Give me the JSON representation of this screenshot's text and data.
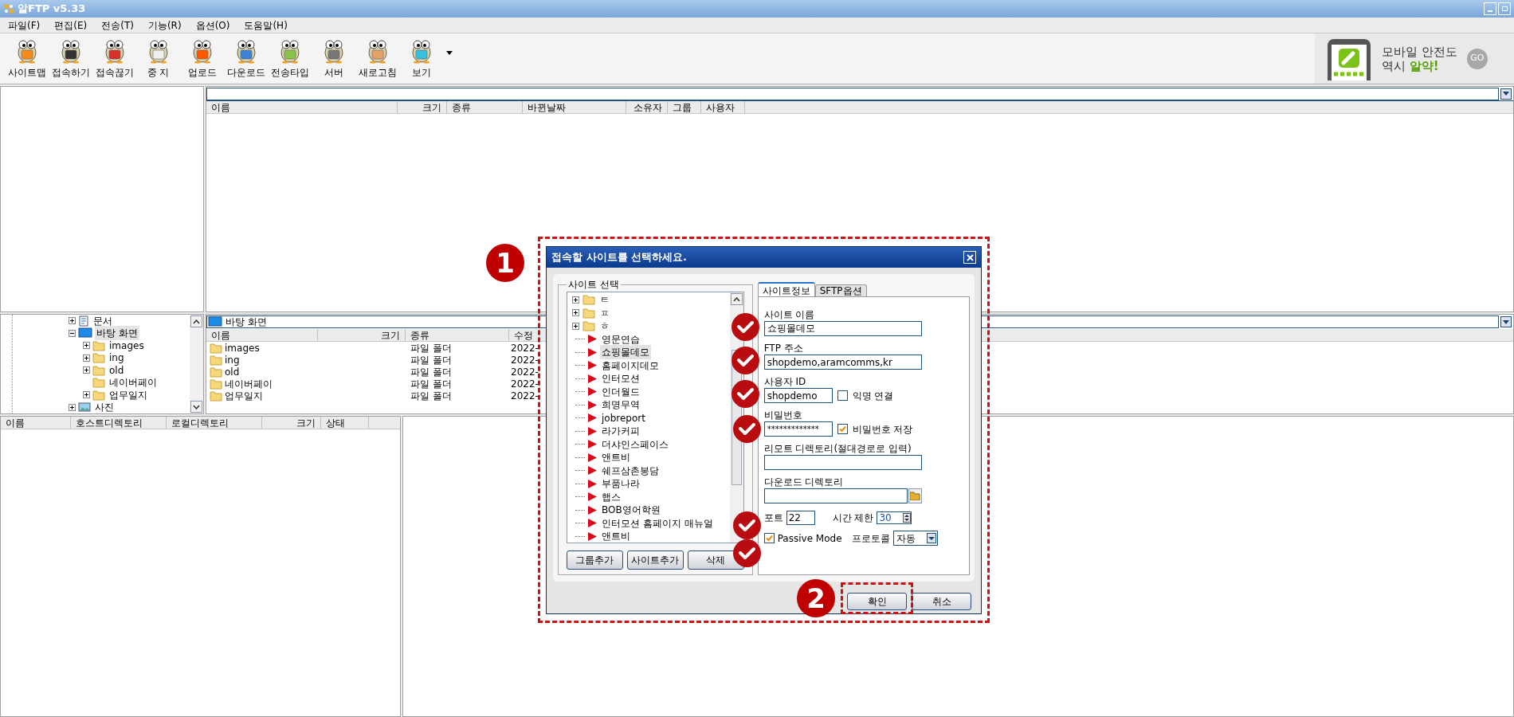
{
  "window": {
    "title": "알FTP  v5.33"
  },
  "menu": [
    {
      "label": "파일(F)"
    },
    {
      "label": "편집(E)"
    },
    {
      "label": "전송(T)"
    },
    {
      "label": "기능(R)"
    },
    {
      "label": "옵션(O)"
    },
    {
      "label": "도움말(H)"
    }
  ],
  "toolbar": [
    {
      "label": "사이트맵"
    },
    {
      "label": "접속하기"
    },
    {
      "label": "접속끊기"
    },
    {
      "label": "중 지"
    },
    {
      "label": "업로드"
    },
    {
      "label": "다운로드"
    },
    {
      "label": "전송타입"
    },
    {
      "label": "서버"
    },
    {
      "label": "새로고침"
    },
    {
      "label": "보기"
    }
  ],
  "ad": {
    "line1": "모바일 안전도",
    "line2": "역시 ",
    "highlight": "알약!",
    "go": "GO"
  },
  "remote": {
    "columns": [
      "이름",
      "크기",
      "종류",
      "바뀐날짜",
      "소유자",
      "그룹",
      "사용자"
    ]
  },
  "local_tree": [
    {
      "label": "문서",
      "kind": "document",
      "expanded": false,
      "selected": false
    },
    {
      "label": "바탕 화면",
      "kind": "desktop",
      "expanded": true,
      "selected": true,
      "children": [
        {
          "label": "images",
          "kind": "folder",
          "expanded": false,
          "selected": false
        },
        {
          "label": "ing",
          "kind": "folder",
          "expanded": false,
          "selected": false
        },
        {
          "label": "old",
          "kind": "folder",
          "expanded": false,
          "selected": false
        },
        {
          "label": "네이버페이",
          "kind": "folder",
          "selected": false
        },
        {
          "label": "업무일지",
          "kind": "folder",
          "expanded": false,
          "selected": false
        }
      ]
    },
    {
      "label": "사진",
      "kind": "pictures",
      "expanded": false,
      "selected": false
    }
  ],
  "local_list": {
    "path": "바탕 화면",
    "columns": [
      "이름",
      "크기",
      "종류",
      "수정"
    ],
    "rows": [
      {
        "name": "images",
        "type": "파일 폴더",
        "date": "2022-"
      },
      {
        "name": "ing",
        "type": "파일 폴더",
        "date": "2022-"
      },
      {
        "name": "old",
        "type": "파일 폴더",
        "date": "2022-"
      },
      {
        "name": "네이버페이",
        "type": "파일 폴더",
        "date": "2022-"
      },
      {
        "name": "업무일지",
        "type": "파일 폴더",
        "date": "2022-"
      }
    ]
  },
  "queue": {
    "columns": [
      "이름",
      "호스트디렉토리",
      "로컬디렉토리",
      "크기",
      "상태"
    ]
  },
  "dialog": {
    "title": "접속할 사이트를 선택하세요.",
    "site_group": {
      "legend": "사이트 선택",
      "items": [
        {
          "kind": "group",
          "label": "ㅌ",
          "expanded": false,
          "selected": false
        },
        {
          "kind": "group",
          "label": "ㅍ",
          "expanded": false,
          "selected": false
        },
        {
          "kind": "group",
          "label": "ㅎ",
          "expanded": false,
          "selected": false
        },
        {
          "kind": "site",
          "label": "영문연습",
          "selected": false
        },
        {
          "kind": "site",
          "label": "쇼핑몰데모",
          "selected": true
        },
        {
          "kind": "site",
          "label": "홈페이지데모",
          "selected": false
        },
        {
          "kind": "site",
          "label": "인터모션",
          "selected": false
        },
        {
          "kind": "site",
          "label": "인더월드",
          "selected": false
        },
        {
          "kind": "site",
          "label": "희명무역",
          "selected": false
        },
        {
          "kind": "site",
          "label": "jobreport",
          "selected": false
        },
        {
          "kind": "site",
          "label": "라가커피",
          "selected": false
        },
        {
          "kind": "site",
          "label": "더샤인스페이스",
          "selected": false
        },
        {
          "kind": "site",
          "label": "앤트비",
          "selected": false
        },
        {
          "kind": "site",
          "label": "쉐프삼촌봉담",
          "selected": false
        },
        {
          "kind": "site",
          "label": "부품나라",
          "selected": false
        },
        {
          "kind": "site",
          "label": "햅스",
          "selected": false
        },
        {
          "kind": "site",
          "label": "BOB영어학원",
          "selected": false
        },
        {
          "kind": "site",
          "label": "인터모션 홈페이지 매뉴얼",
          "selected": false
        },
        {
          "kind": "site",
          "label": "앤트비",
          "selected": false
        }
      ],
      "buttons": [
        "그룹추가",
        "사이트추가",
        "삭제"
      ]
    },
    "tabs": [
      {
        "label": "사이트정보",
        "selected": true
      },
      {
        "label": "SFTP옵션",
        "selected": false
      }
    ],
    "form": {
      "site_name": {
        "label": "사이트 이름",
        "value": "쇼핑몰데모"
      },
      "ftp_address": {
        "label": "FTP 주소",
        "value": "shopdemo,aramcomms,kr"
      },
      "user_id": {
        "label": "사용자 ID",
        "value": "shopdemo"
      },
      "anonymous": {
        "label": "익명 연결",
        "checked": false
      },
      "password": {
        "label": "비밀번호",
        "value": "*************"
      },
      "save_password": {
        "label": "비밀번호 저장",
        "checked": true
      },
      "remote_dir": {
        "label": "리모트 디렉토리(절대경로로 입력)"
      },
      "download_dir": {
        "label": "다운로드 디렉토리"
      },
      "port": {
        "label": "포트",
        "value": "22"
      },
      "timeout": {
        "label": "시간 제한",
        "value": "30"
      },
      "passive": {
        "label": "Passive Mode",
        "checked": true
      },
      "protocol": {
        "label": "프로토콜",
        "value": "자동"
      }
    },
    "buttons": [
      "확인",
      "취소"
    ]
  },
  "annotations": [
    {
      "label": "1"
    },
    {
      "label": "2"
    }
  ]
}
